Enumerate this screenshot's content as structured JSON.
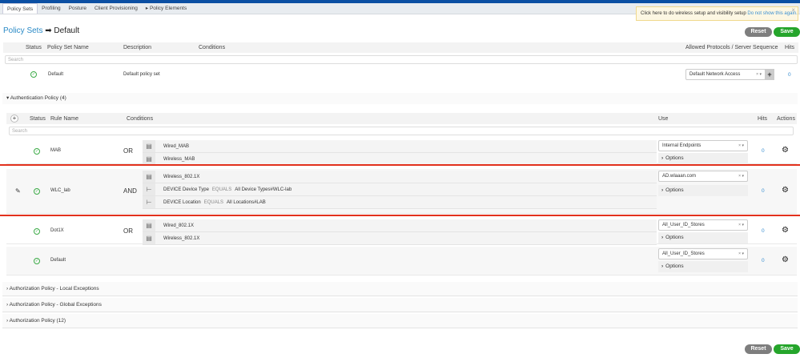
{
  "subnav": {
    "tabs": [
      "Policy Sets",
      "Profiling",
      "Posture",
      "Client Provisioning",
      "▸ Policy Elements"
    ]
  },
  "banner": {
    "text": "Click here to do wireless setup and visibility setup",
    "link": "Do not show this again.",
    "close": "×"
  },
  "title": {
    "link": "Policy Sets",
    "arrow": "➡",
    "current": "Default"
  },
  "buttons": {
    "reset": "Reset",
    "save": "Save"
  },
  "policy_set_table": {
    "headers": [
      "Status",
      "Policy Set Name",
      "Description",
      "Conditions",
      "Allowed Protocols / Server Sequence",
      "Hits"
    ],
    "search_placeholder": "Search",
    "row": {
      "name": "Default",
      "description": "Default policy set",
      "protocol": "Default Network Access",
      "hits": "0"
    }
  },
  "auth_policy": {
    "title": "Authentication Policy (4)",
    "headers": {
      "add": "+",
      "status": "Status",
      "rule_name": "Rule Name",
      "conditions": "Conditions",
      "use": "Use",
      "hits": "Hits",
      "actions": "Actions"
    },
    "search_placeholder": "Search",
    "options_label": "Options",
    "rules": [
      {
        "name": "MAB",
        "operator": "OR",
        "use": "Internal Endpoints",
        "hits": "0",
        "conditions": [
          {
            "icon": "library-condition",
            "parts": [
              "Wired_MAB"
            ]
          },
          {
            "icon": "library-condition",
            "parts": [
              "Wireless_MAB"
            ]
          }
        ]
      },
      {
        "name": "WLC_lab",
        "operator": "AND",
        "use": "AD.wlaaan.com",
        "hits": "0",
        "editing": true,
        "conditions": [
          {
            "icon": "library-condition",
            "parts": [
              "Wireless_802.1X"
            ]
          },
          {
            "icon": "attribute-condition",
            "parts": [
              "DEVICE Device Type",
              "EQUALS",
              "All Device Types#WLC-lab"
            ]
          },
          {
            "icon": "attribute-condition",
            "parts": [
              "DEVICE Location",
              "EQUALS",
              "All Locations#LAB"
            ]
          }
        ]
      },
      {
        "name": "Dot1X",
        "operator": "OR",
        "use": "All_User_ID_Stores",
        "hits": "0",
        "conditions": [
          {
            "icon": "library-condition",
            "parts": [
              "Wired_802.1X"
            ]
          },
          {
            "icon": "library-condition",
            "parts": [
              "Wireless_802.1X"
            ]
          }
        ]
      },
      {
        "name": "Default",
        "operator": "",
        "use": "All_User_ID_Stores",
        "hits": "0",
        "conditions": []
      }
    ]
  },
  "sections": [
    "Authorization Policy - Local Exceptions",
    "Authorization Policy - Global Exceptions",
    "Authorization Policy (12)"
  ],
  "colors": {
    "accent": "#2a8ac6",
    "save": "#25a52b",
    "reset": "#7e7e7e",
    "highlight": "#e2311d",
    "status_ok": "#3cab47"
  }
}
